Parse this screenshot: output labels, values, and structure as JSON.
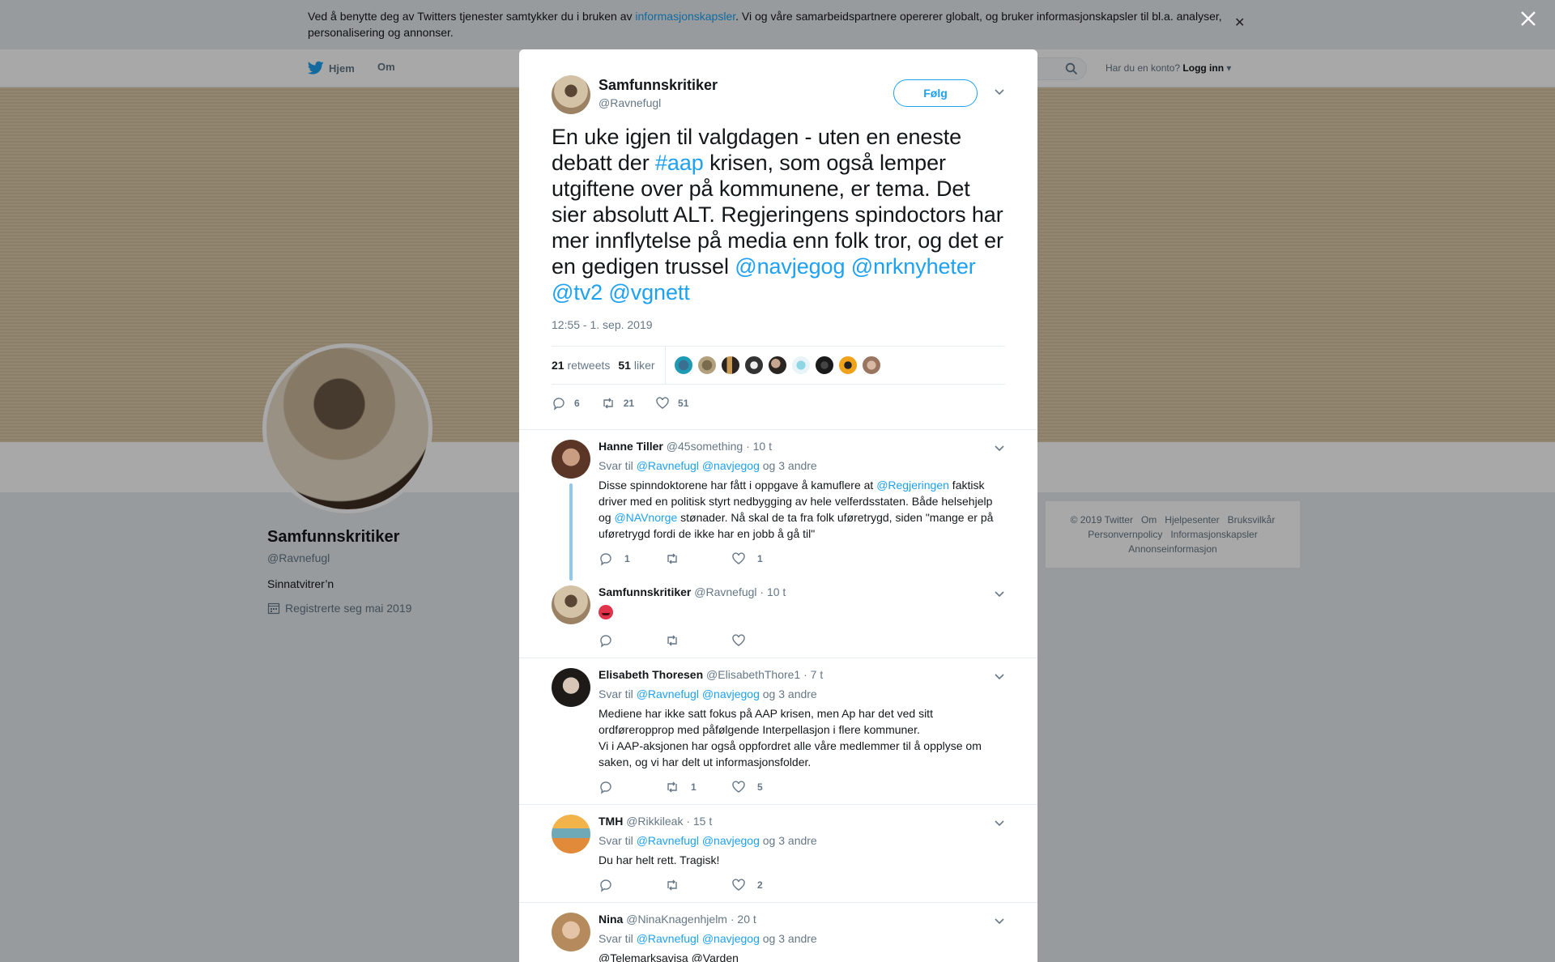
{
  "cookie": {
    "text_before": "Ved å benytte deg av Twitters tjenester samtykker du i bruken av ",
    "link": "informasjonskapsler",
    "text_after": ". Vi og våre samarbeidspartnere opererer globalt, og bruker informasjonskapsler til bl.a. analyser, personalisering og annonser."
  },
  "nav": {
    "home": "Hjem",
    "about": "Om",
    "have_account": "Har du en konto?",
    "login": "Logg inn"
  },
  "profile": {
    "name": "Samfunnskritiker",
    "handle": "@Ravnefugl",
    "bio": "Sinnatvitrer’n",
    "joined": "Registrerte seg mai 2019"
  },
  "footer": {
    "items": [
      "© 2019 Twitter",
      "Om",
      "Hjelpesenter",
      "Bruksvilkår",
      "Personvernpolicy",
      "Informasjonskapsler",
      "Annonseinformasjon"
    ]
  },
  "tweet": {
    "name": "Samfunnskritiker",
    "handle": "@Ravnefugl",
    "follow": "Følg",
    "text_1": "En uke igjen til valgdagen - uten en eneste debatt der ",
    "hashtag": "#aap",
    "text_2": " krisen, som også lemper utgiftene over på kommunene, er tema. Det sier absolutt ALT. Regjeringens spindoctors har mer innflytelse på media enn folk tror, og det er en gedigen trussel ",
    "mentions": "@navjegog @nrknyheter @tv2 @vgnett",
    "time": "12:55 - 1. sep. 2019",
    "retweets_count": "21",
    "retweets_label": "retweets",
    "likes_count": "51",
    "likes_label": "liker",
    "actions": {
      "reply": "6",
      "retweet": "21",
      "like": "51"
    }
  },
  "replies": [
    {
      "name": "Hanne Tiller",
      "handle": "@45something",
      "time": "· 10 t",
      "reply_prefix": "Svar til",
      "reply_to": "@Ravnefugl @navjegog",
      "reply_suffix": "og 3 andre",
      "text_a": "Disse spinndoktorene har fått i oppgave å kamuflere at ",
      "mention_a": "@Regjeringen",
      "text_b": " faktisk driver med en politisk styrt nedbygging av hele velferdsstaten. Både helsehjelp og ",
      "mention_b": "@NAVnorge",
      "text_c": " stønader. Nå skal de ta fra folk uføretrygd, siden \"mange er på uføretrygd fordi de ikke har en jobb å gå til\"",
      "reply": "1",
      "retweet": "",
      "like": "1"
    },
    {
      "name": "Samfunnskritiker",
      "handle": "@Ravnefugl",
      "time": "· 10 t",
      "reply": "",
      "retweet": "",
      "like": ""
    },
    {
      "name": "Elisabeth Thoresen",
      "handle": "@ElisabethThore1",
      "time": "· 7 t",
      "reply_prefix": "Svar til",
      "reply_to": "@Ravnefugl @navjegog",
      "reply_suffix": "og 3 andre",
      "text_1": "Mediene har ikke satt fokus på AAP krisen, men Ap har det ved sitt ordføreropprop med påfølgende Interpellasjon i flere kommuner.",
      "text_2": "Vi i AAP-aksjonen har også oppfordret alle våre medlemmer til å opplyse om saken, og vi har delt ut informasjonsfolder.",
      "reply": "",
      "retweet": "1",
      "like": "5"
    },
    {
      "name": "TMH",
      "handle": "@Rikkileak",
      "time": "· 15 t",
      "reply_prefix": "Svar til",
      "reply_to": "@Ravnefugl @navjegog",
      "reply_suffix": "og 3 andre",
      "text": "Du har helt rett. Tragisk!",
      "reply": "",
      "retweet": "",
      "like": "2"
    },
    {
      "name": "Nina",
      "handle": "@NinaKnagenhjelm",
      "time": "· 20 t",
      "reply_prefix": "Svar til",
      "reply_to": "@Ravnefugl @navjegog",
      "reply_suffix": "og 3 andre",
      "mentions": "@Telemarksavisa @Varden"
    }
  ],
  "colors": {
    "accent": "#1da1f2",
    "muted": "#657786",
    "text": "#14171a"
  }
}
